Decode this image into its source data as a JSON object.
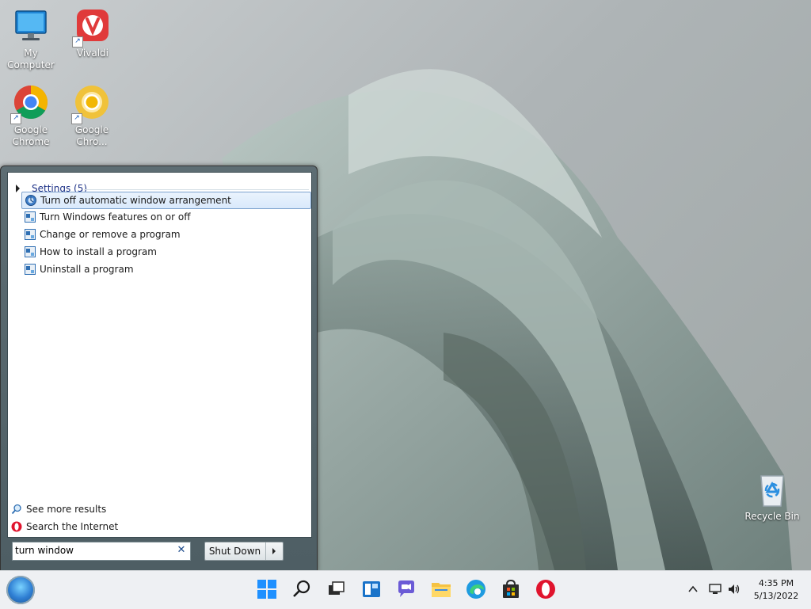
{
  "desktop": {
    "icons": [
      {
        "label": "My Computer",
        "icon": "computer-icon"
      },
      {
        "label": "Vivaldi",
        "icon": "vivaldi-icon"
      },
      {
        "label": "Google Chrome",
        "icon": "chrome-icon"
      },
      {
        "label": "Google Chro...",
        "icon": "chrome-beta-icon"
      },
      {
        "label": "Recycle Bin",
        "icon": "recycle-bin-icon"
      }
    ]
  },
  "start_menu": {
    "group": {
      "label": "Settings (5)"
    },
    "results": [
      {
        "label": "Turn off automatic window arrangement",
        "selected": true
      },
      {
        "label": "Turn Windows features on or off"
      },
      {
        "label": "Change or remove a program"
      },
      {
        "label": "How to install a program"
      },
      {
        "label": "Uninstall a program"
      }
    ],
    "see_more": "See more results",
    "search_internet": "Search the Internet",
    "search_value": "turn window",
    "shutdown_label": "Shut Down"
  },
  "taskbar": {
    "apps": [
      "windows-start-icon",
      "search-icon",
      "task-view-icon",
      "widgets-icon",
      "chat-icon",
      "file-explorer-icon",
      "edge-icon",
      "store-icon",
      "opera-icon"
    ],
    "clock_time": "4:35 PM",
    "clock_date": "5/13/2022"
  },
  "colors": {
    "accent": "#1e3287",
    "taskbar": "#eef0f3"
  }
}
